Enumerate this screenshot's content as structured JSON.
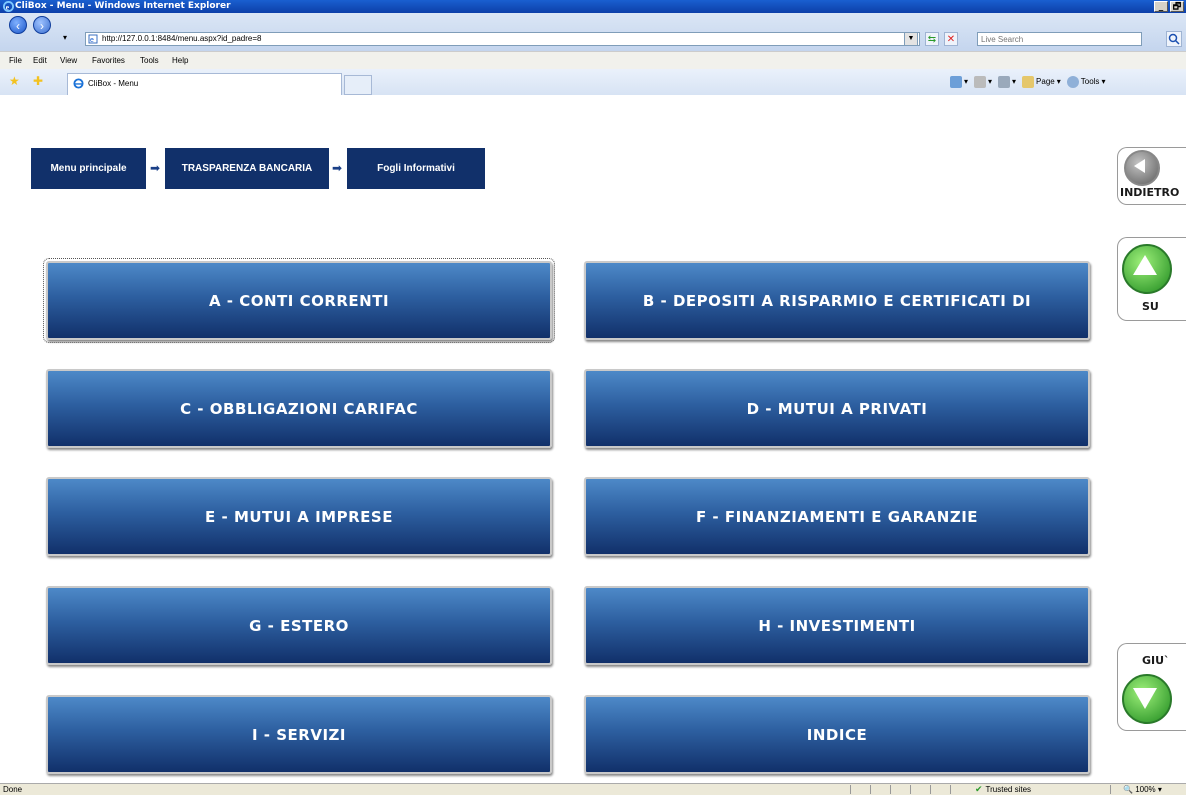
{
  "window": {
    "title": "CliBox - Menu - Windows Internet Explorer",
    "buttons": [
      "_",
      "🗗"
    ]
  },
  "address_bar": {
    "url": "http://127.0.0.1:8484/menu.aspx?id_padre=8",
    "search_placeholder": "Live Search"
  },
  "menu_bar": {
    "items": [
      "File",
      "Edit",
      "View",
      "Favorites",
      "Tools",
      "Help"
    ]
  },
  "tab_bar": {
    "active_tab": "CliBox - Menu",
    "commands": {
      "page": "Page",
      "tools": "Tools"
    }
  },
  "breadcrumb": {
    "items": [
      "Menu principale",
      "TRASPARENZA BANCARIA",
      "Fogli Informativi"
    ]
  },
  "menu": {
    "buttons": [
      "A - CONTI CORRENTI",
      "B - DEPOSITI A RISPARMIO E CERTIFICATI DI",
      "C - OBBLIGAZIONI CARIFAC",
      "D - MUTUI A PRIVATI",
      "E - MUTUI A IMPRESE",
      "F - FINANZIAMENTI E GARANZIE",
      "G - ESTERO",
      "H - INVESTIMENTI",
      "I - SERVIZI",
      "INDICE"
    ]
  },
  "side_nav": {
    "back_label": "INDIETRO",
    "up_label": "SU",
    "down_label": "GIU`"
  },
  "status_bar": {
    "status": "Done",
    "zone": "Trusted sites",
    "zoom": "100%"
  },
  "colors": {
    "button_dark": "#11306a",
    "button_light": "#4d89c8",
    "green": "#1e8a1e"
  }
}
